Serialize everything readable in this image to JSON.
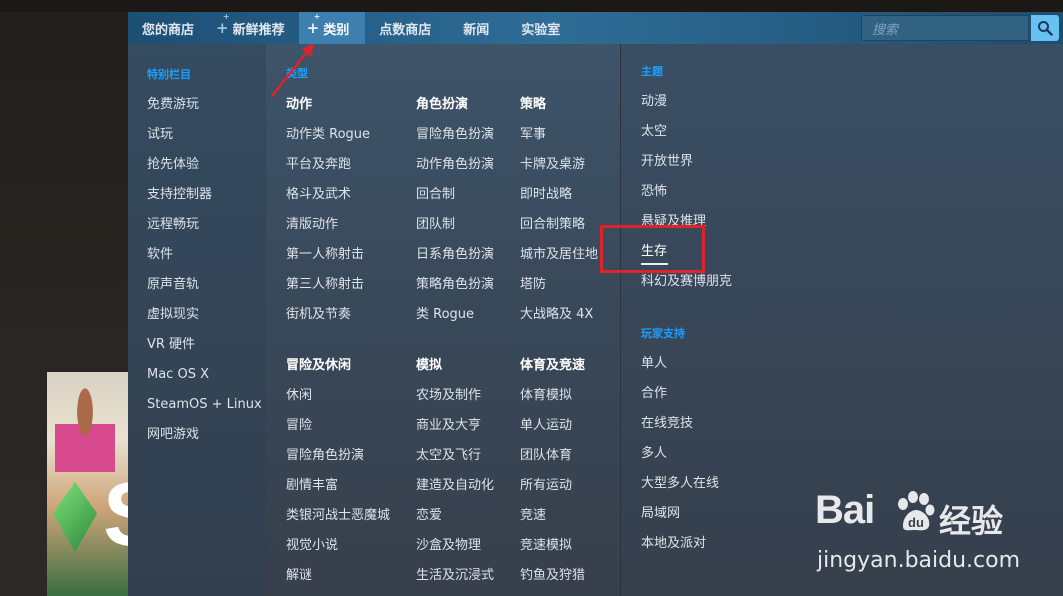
{
  "nav": {
    "items": [
      {
        "label": "您的商店",
        "plus": false
      },
      {
        "label": "新鲜推荐",
        "plus": true
      },
      {
        "label": "类别",
        "plus": true,
        "active": true
      },
      {
        "label": "点数商店",
        "plus": false
      },
      {
        "label": "新闻",
        "plus": false
      },
      {
        "label": "实验室",
        "plus": false
      }
    ],
    "search_placeholder": "搜索"
  },
  "special": {
    "header": "特别栏目",
    "items": [
      "免费游玩",
      "试玩",
      "抢先体验",
      "支持控制器",
      "远程畅玩",
      "软件",
      "原声音轨",
      "虚拟现实",
      "VR 硬件",
      "Mac OS X",
      "SteamOS + Linux",
      "网吧游戏"
    ]
  },
  "genre": {
    "header": "类型",
    "groups": [
      {
        "title": "动作",
        "items": [
          "动作类 Rogue",
          "平台及奔跑",
          "格斗及武术",
          "清版动作",
          "第一人称射击",
          "第三人称射击",
          "街机及节奏"
        ]
      },
      {
        "title": "角色扮演",
        "items": [
          "冒险角色扮演",
          "动作角色扮演",
          "回合制",
          "团队制",
          "日系角色扮演",
          "策略角色扮演",
          "类 Rogue"
        ]
      },
      {
        "title": "策略",
        "items": [
          "军事",
          "卡牌及桌游",
          "即时战略",
          "回合制策略",
          "城市及居住地",
          "塔防",
          "大战略及 4X"
        ]
      },
      {
        "title": "冒险及休闲",
        "items": [
          "休闲",
          "冒险",
          "冒险角色扮演",
          "剧情丰富",
          "类银河战士恶魔城",
          "视觉小说",
          "解谜"
        ]
      },
      {
        "title": "模拟",
        "items": [
          "农场及制作",
          "商业及大亨",
          "太空及飞行",
          "建造及自动化",
          "恋爱",
          "沙盒及物理",
          "生活及沉浸式"
        ]
      },
      {
        "title": "体育及竞速",
        "items": [
          "体育模拟",
          "单人运动",
          "团队体育",
          "所有运动",
          "竞速",
          "竞速模拟",
          "钓鱼及狩猎"
        ]
      }
    ]
  },
  "themes": {
    "header": "主题",
    "items": [
      "动漫",
      "太空",
      "开放世界",
      "恐怖",
      "悬疑及推理",
      "生存",
      "科幻及赛博朋克"
    ]
  },
  "player_support": {
    "header": "玩家支持",
    "items": [
      "单人",
      "合作",
      "在线竞技",
      "多人",
      "大型多人在线",
      "局域网",
      "本地及派对"
    ]
  },
  "watermark": {
    "brand_a": "Bai",
    "brand_b": "经验",
    "url": "jingyan.baidu.com"
  },
  "colors": {
    "accent_blue": "#1a9fff",
    "annotation_red": "#e0222a"
  }
}
